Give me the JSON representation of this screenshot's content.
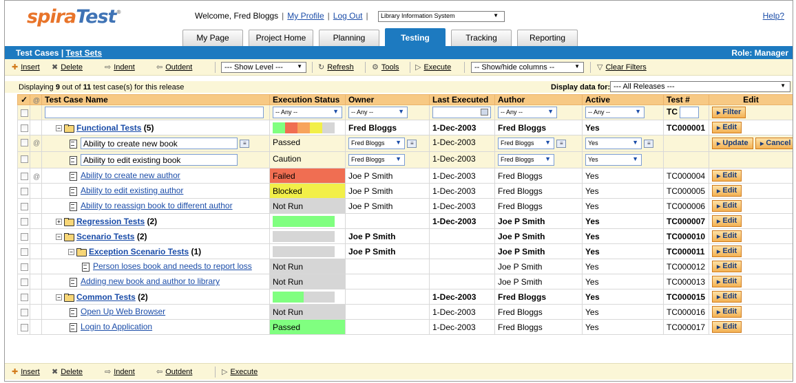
{
  "app": {
    "logo_a": "spira",
    "logo_b": "Test",
    "logo_mark": "®"
  },
  "header": {
    "welcome": "Welcome, Fred Bloggs",
    "my_profile": "My Profile",
    "log_out": "Log Out",
    "project": "Library Information System",
    "help": "Help?"
  },
  "tabs": [
    {
      "label": "My Page"
    },
    {
      "label": "Project Home"
    },
    {
      "label": "Planning"
    },
    {
      "label": "Testing",
      "active": true
    },
    {
      "label": "Tracking"
    },
    {
      "label": "Reporting"
    }
  ],
  "subbar": {
    "test_cases": "Test Cases",
    "divider": "|",
    "test_sets": "Test Sets",
    "role": "Role: Manager"
  },
  "toolbar": {
    "insert": "Insert",
    "delete": "Delete",
    "indent": "Indent",
    "outdent": "Outdent",
    "show_level": "--- Show Level ---",
    "refresh": "Refresh",
    "tools": "Tools",
    "execute": "Execute",
    "show_hide": "-- Show/hide columns --",
    "clear_filters": "Clear Filters"
  },
  "status": {
    "prefix": "Displaying ",
    "shown": "9",
    "mid": " out of ",
    "total": "11",
    "suffix": " test case(s) for this release",
    "display_for": "Display data for:",
    "release": "--- All Releases ---"
  },
  "columns": {
    "check": "✓",
    "attach": "@",
    "name": "Test Case Name",
    "exec": "Execution Status",
    "owner": "Owner",
    "last": "Last Executed",
    "author": "Author",
    "active": "Active",
    "test_no": "Test #",
    "edit": "Edit"
  },
  "filter": {
    "any": "-- Any --",
    "tc": "TC",
    "filter_btn": "Filter"
  },
  "buttons": {
    "edit": "Edit",
    "update": "Update",
    "cancel": "Cancel"
  },
  "colors": {
    "passed": "#80ff80",
    "failed": "#f06e52",
    "blocked": "#f2ef49",
    "caution": "#f7a35c",
    "not_run": "#d6d6d6",
    "header": "#f7c984",
    "toolbar": "#fbf6d7",
    "brand": "#1d7ac0"
  },
  "rows": {
    "r0": {
      "name": "Functional Tests",
      "count": " (5)",
      "owner": "Fred Bloggs",
      "last": "1-Dec-2003",
      "author": "Fred Bloggs",
      "active": "Yes",
      "id": "TC000001",
      "progress": {
        "passed": 0.2,
        "failed": 0.2,
        "caution": 0.2,
        "blocked": 0.2,
        "not_run": 0.2
      }
    },
    "r1": {
      "name": "Ability to create new book",
      "exec": "Passed",
      "owner": "Fred Bloggs",
      "last": "1-Dec-2003",
      "author": "Fred Bloggs",
      "active": "Yes"
    },
    "r2": {
      "name": "Ability to edit existing book",
      "exec": "Caution",
      "owner": "Fred Bloggs",
      "last": "1-Dec-2003",
      "author": "Fred Bloggs",
      "active": "Yes"
    },
    "r3": {
      "name": "Ability to create new author",
      "exec": "Failed",
      "owner": "Joe P Smith",
      "last": "1-Dec-2003",
      "author": "Fred Bloggs",
      "active": "Yes",
      "id": "TC000004"
    },
    "r4": {
      "name": "Ability to edit existing author",
      "exec": "Blocked",
      "owner": "Joe P Smith",
      "last": "1-Dec-2003",
      "author": "Fred Bloggs",
      "active": "Yes",
      "id": "TC000005"
    },
    "r5": {
      "name": "Ability to reassign book to different author",
      "exec": "Not Run",
      "owner": "Joe P Smith",
      "last": "1-Dec-2003",
      "author": "Fred Bloggs",
      "active": "Yes",
      "id": "TC000006"
    },
    "r6": {
      "name": "Regression Tests",
      "count": " (2)",
      "last": "1-Dec-2003",
      "author": "Joe P Smith",
      "active": "Yes",
      "id": "TC000007",
      "progress": {
        "passed": 1.0
      }
    },
    "r7": {
      "name": "Scenario Tests",
      "count": " (2)",
      "owner": "Joe P Smith",
      "author": "Joe P Smith",
      "active": "Yes",
      "id": "TC000010",
      "progress": {
        "not_run": 1.0
      }
    },
    "r8": {
      "name": "Exception Scenario Tests",
      "count": " (1)",
      "owner": "Joe P Smith",
      "author": "Joe P Smith",
      "active": "Yes",
      "id": "TC000011",
      "progress": {
        "not_run": 1.0
      }
    },
    "r9": {
      "name": "Person loses book and needs to report loss",
      "exec": "Not Run",
      "author": "Joe P Smith",
      "active": "Yes",
      "id": "TC000012"
    },
    "r10": {
      "name": "Adding new book and author to library",
      "exec": "Not Run",
      "author": "Joe P Smith",
      "active": "Yes",
      "id": "TC000013"
    },
    "r11": {
      "name": "Common Tests",
      "count": " (2)",
      "last": "1-Dec-2003",
      "author": "Fred Bloggs",
      "active": "Yes",
      "id": "TC000015",
      "progress": {
        "passed": 0.5,
        "not_run": 0.5
      }
    },
    "r12": {
      "name": "Open Up Web Browser",
      "exec": "Not Run",
      "last": "1-Dec-2003",
      "author": "Fred Bloggs",
      "active": "Yes",
      "id": "TC000016"
    },
    "r13": {
      "name": "Login to Application",
      "exec": "Passed",
      "last": "1-Dec-2003",
      "author": "Fred Bloggs",
      "active": "Yes",
      "id": "TC000017"
    }
  }
}
